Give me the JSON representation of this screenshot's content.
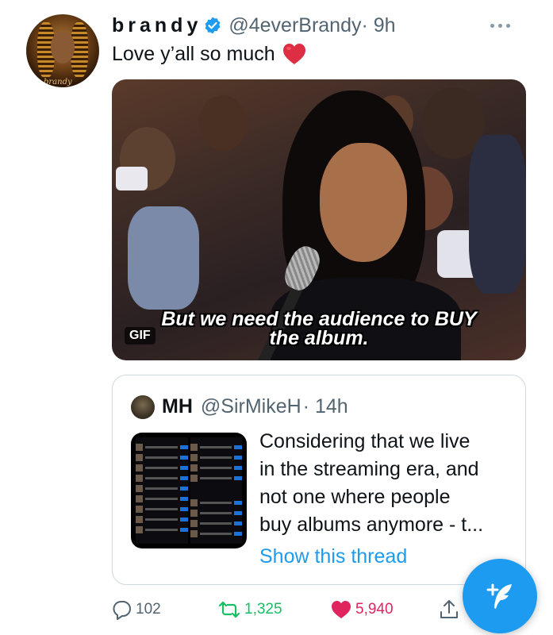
{
  "author": {
    "display_name": "brandy",
    "handle": "@4everBrandy",
    "time": "· 9h",
    "avatar_signature": "brandy",
    "verified": true
  },
  "tweet": {
    "text": "Love y’all so much",
    "emoji": "red-heart"
  },
  "media": {
    "caption_line1": "But we need the audience to BUY",
    "caption_line2": "the album.",
    "badge": "GIF"
  },
  "quote": {
    "display_name": "MH",
    "handle": "@SirMikeH",
    "time": "· 14h",
    "text_lines": [
      "Considering that we live",
      "in the streaming era, and",
      "not one where people",
      "buy albums anymore - t..."
    ],
    "link": "Show this thread"
  },
  "actions": {
    "replies": "102",
    "retweets": "1,325",
    "likes": "5,940"
  },
  "colors": {
    "accent": "#1d9bf0",
    "retweet": "#17bf63",
    "like": "#e0245e",
    "secondary_text": "#536471"
  }
}
